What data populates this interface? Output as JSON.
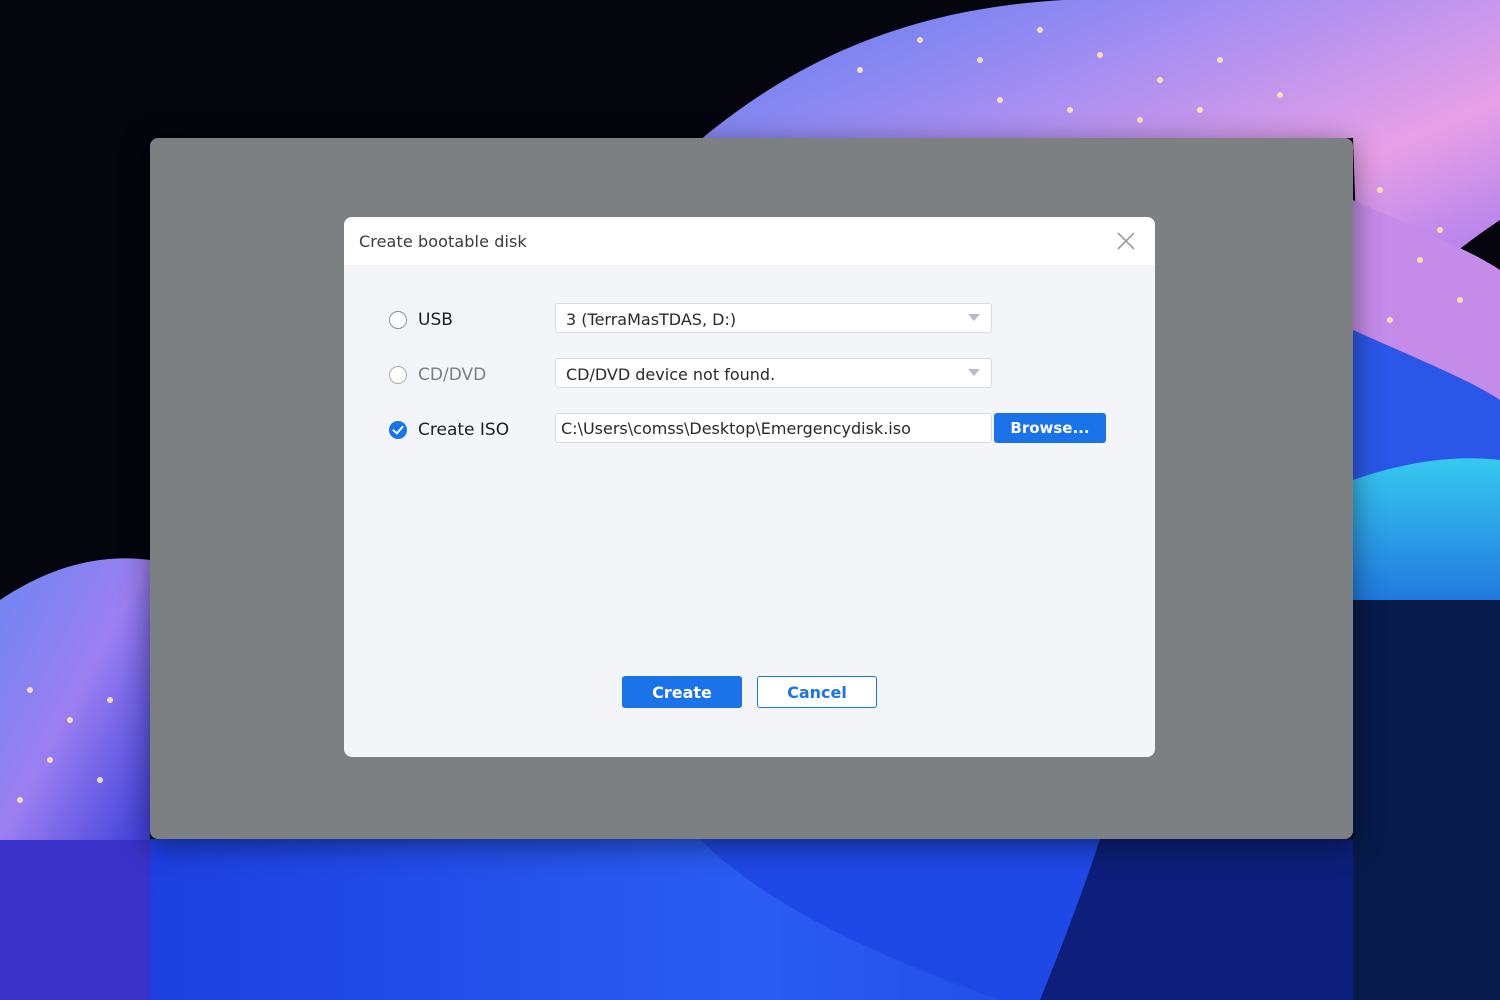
{
  "dialog": {
    "title": "Create bootable disk",
    "close_icon": "close-icon"
  },
  "options": {
    "usb": {
      "label": "USB",
      "selected": false,
      "device_value": "3 (TerraMasTDAS, D:)"
    },
    "cd_dvd": {
      "label": "CD/DVD",
      "selected": false,
      "device_value": "CD/DVD device not found."
    },
    "iso": {
      "label": "Create ISO",
      "selected": true,
      "path_value": "C:\\Users\\comss\\Desktop\\Emergencydisk.iso",
      "browse_label": "Browse..."
    }
  },
  "actions": {
    "create_label": "Create",
    "cancel_label": "Cancel"
  },
  "colors": {
    "accent": "#1a73e8",
    "overlay": "#7d8083",
    "dialog_bg": "#f4f5f9"
  }
}
